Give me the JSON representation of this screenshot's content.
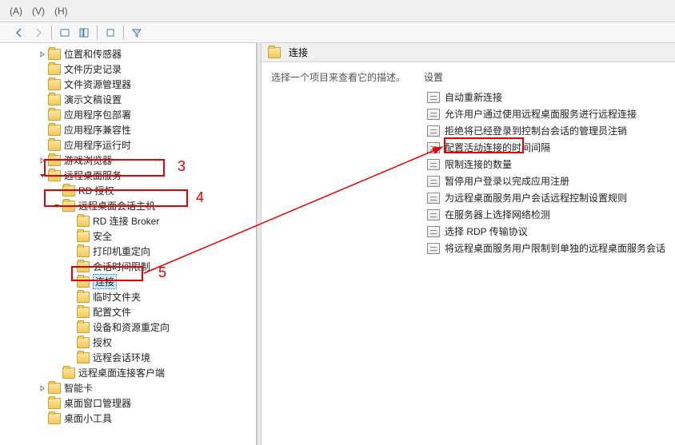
{
  "menu": {
    "m1": "(A)",
    "m2": "(V)",
    "m3": "(H)"
  },
  "tree": {
    "items": [
      {
        "indent": 2,
        "caret": "right",
        "label": "位置和传感器"
      },
      {
        "indent": 2,
        "caret": "blank",
        "label": "文件历史记录"
      },
      {
        "indent": 2,
        "caret": "blank",
        "label": "文件资源管理器"
      },
      {
        "indent": 2,
        "caret": "blank",
        "label": "演示文稿设置"
      },
      {
        "indent": 2,
        "caret": "blank",
        "label": "应用程序包部署"
      },
      {
        "indent": 2,
        "caret": "blank",
        "label": "应用程序兼容性"
      },
      {
        "indent": 2,
        "caret": "blank",
        "label": "应用程序运行时"
      },
      {
        "indent": 2,
        "caret": "right",
        "label": "游戏浏览器"
      },
      {
        "indent": 2,
        "caret": "down",
        "label": "远程桌面服务"
      },
      {
        "indent": 3,
        "caret": "blank",
        "label": "RD 授权"
      },
      {
        "indent": 3,
        "caret": "down",
        "label": "远程桌面会话主机"
      },
      {
        "indent": 4,
        "caret": "blank",
        "label": "RD 连接 Broker"
      },
      {
        "indent": 4,
        "caret": "blank",
        "label": "安全"
      },
      {
        "indent": 4,
        "caret": "blank",
        "label": "打印机重定向"
      },
      {
        "indent": 4,
        "caret": "blank",
        "label": "会话时间限制"
      },
      {
        "indent": 4,
        "caret": "blank",
        "label": "连接",
        "selected": true
      },
      {
        "indent": 4,
        "caret": "blank",
        "label": "临时文件夹"
      },
      {
        "indent": 4,
        "caret": "blank",
        "label": "配置文件"
      },
      {
        "indent": 4,
        "caret": "blank",
        "label": "设备和资源重定向"
      },
      {
        "indent": 4,
        "caret": "blank",
        "label": "授权"
      },
      {
        "indent": 4,
        "caret": "blank",
        "label": "远程会话环境"
      },
      {
        "indent": 3,
        "caret": "blank",
        "label": "远程桌面连接客户端"
      },
      {
        "indent": 2,
        "caret": "right",
        "label": "智能卡"
      },
      {
        "indent": 2,
        "caret": "blank",
        "label": "桌面窗口管理器"
      },
      {
        "indent": 2,
        "caret": "blank",
        "label": "桌面小工具"
      }
    ]
  },
  "right": {
    "header": "连接",
    "description": "选择一个项目来查看它的描述。",
    "settingsHeading": "设置",
    "policies": [
      "自动重新连接",
      "允许用户通过使用远程桌面服务进行远程连接",
      "拒绝将已经登录到控制台会话的管理员注销",
      "配置活动连接的时间间隔",
      "限制连接的数量",
      "暂停用户登录以完成应用注册",
      "为远程桌面服务用户会话远程控制设置规则",
      "在服务器上选择网络检测",
      "选择 RDP 传输协议",
      "将远程桌面服务用户限制到单独的远程桌面服务会话"
    ]
  },
  "annotations": {
    "n3": "3",
    "n4": "4",
    "n5": "5"
  }
}
